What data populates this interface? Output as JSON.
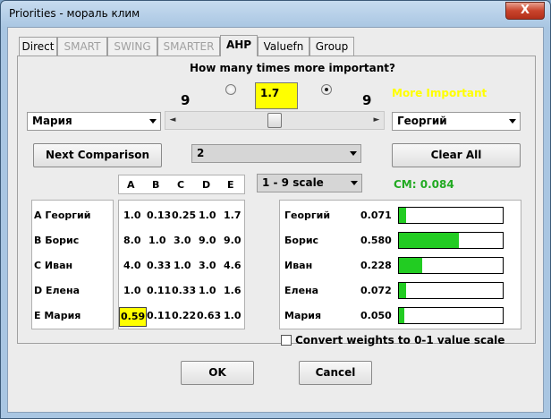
{
  "window": {
    "title": "Priorities - мораль клим",
    "close_glyph": "X"
  },
  "tabs": [
    {
      "label": "Direct",
      "state": "normal"
    },
    {
      "label": "SMART",
      "state": "disabled"
    },
    {
      "label": "SWING",
      "state": "disabled"
    },
    {
      "label": "SMARTER",
      "state": "disabled"
    },
    {
      "label": "AHP",
      "state": "active"
    },
    {
      "label": "Valuefn",
      "state": "normal"
    },
    {
      "label": "Group",
      "state": "normal"
    }
  ],
  "comparison": {
    "question": "How many times more important?",
    "value": "1.7",
    "left_scale": "9",
    "right_scale": "9",
    "more_important_label": "More Important",
    "left_radio_selected": false,
    "right_radio_selected": true,
    "left_item": "Мария",
    "right_item": "Георгий",
    "slider_arrow_left": "◄",
    "slider_arrow_right": "►",
    "slider_position": 0.5
  },
  "buttons": {
    "next_comparison": "Next Comparison",
    "clear_all": "Clear All",
    "ok": "OK",
    "cancel": "Cancel"
  },
  "comparison_number": "2",
  "scale_select": "1 - 9 scale",
  "cm_label": "CM: 0.084",
  "matrix": {
    "columns": [
      "A",
      "B",
      "C",
      "D",
      "E"
    ],
    "rows": [
      {
        "label": "A Георгий",
        "values": [
          "1.0",
          "0.13",
          "0.25",
          "1.0",
          "1.7"
        ]
      },
      {
        "label": "B Борис",
        "values": [
          "8.0",
          "1.0",
          "3.0",
          "9.0",
          "9.0"
        ]
      },
      {
        "label": "C Иван",
        "values": [
          "4.0",
          "0.33",
          "1.0",
          "3.0",
          "4.6"
        ]
      },
      {
        "label": "D Елена",
        "values": [
          "1.0",
          "0.11",
          "0.33",
          "1.0",
          "1.6"
        ]
      },
      {
        "label": "E Мария",
        "values": [
          "0.59",
          "0.11",
          "0.22",
          "0.63",
          "1.0"
        ]
      }
    ],
    "highlight": {
      "row": 4,
      "col": 0
    }
  },
  "weights": [
    {
      "name": "Георгий",
      "value": "0.071",
      "fraction": 0.071
    },
    {
      "name": "Борис",
      "value": "0.580",
      "fraction": 0.58
    },
    {
      "name": "Иван",
      "value": "0.228",
      "fraction": 0.228
    },
    {
      "name": "Елена",
      "value": "0.072",
      "fraction": 0.072
    },
    {
      "name": "Мария",
      "value": "0.050",
      "fraction": 0.05
    }
  ],
  "convert_checkbox": {
    "label": "Convert weights to 0-1 value scale",
    "checked": false
  },
  "colors": {
    "highlight": "#ffff00",
    "accent_yellow": "#ffff00",
    "cm_green": "#22aa22",
    "bar_green": "#22cc22"
  }
}
